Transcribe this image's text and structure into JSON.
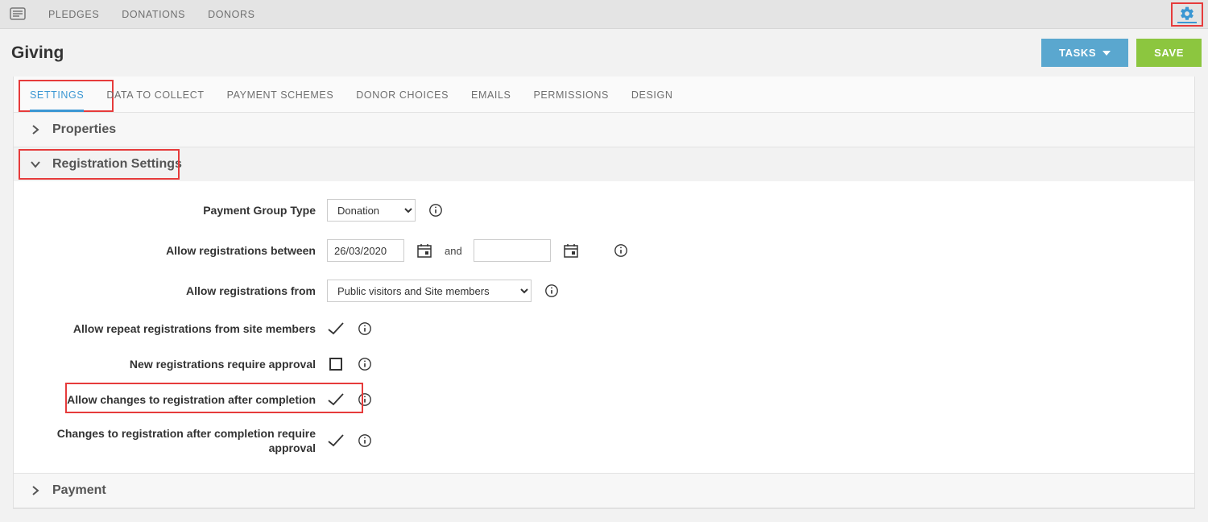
{
  "topnav": {
    "items": [
      "PLEDGES",
      "DONATIONS",
      "DONORS"
    ]
  },
  "header": {
    "title": "Giving",
    "tasks_label": "TASKS",
    "save_label": "SAVE"
  },
  "tabs": [
    "SETTINGS",
    "DATA TO COLLECT",
    "PAYMENT SCHEMES",
    "DONOR CHOICES",
    "EMAILS",
    "PERMISSIONS",
    "DESIGN"
  ],
  "sections": {
    "properties": "Properties",
    "registration": "Registration Settings",
    "payment": "Payment"
  },
  "form": {
    "payment_group_type": {
      "label": "Payment Group Type",
      "value": "Donation"
    },
    "allow_between": {
      "label": "Allow registrations between",
      "from": "26/03/2020",
      "to": "",
      "and": "and"
    },
    "allow_from": {
      "label": "Allow registrations from",
      "value": "Public visitors and Site members"
    },
    "repeat": {
      "label": "Allow repeat registrations from site members",
      "checked": true
    },
    "approval": {
      "label": "New registrations require approval",
      "checked": false
    },
    "changes": {
      "label": "Allow changes to registration after completion",
      "checked": true
    },
    "changes_approval": {
      "label": "Changes to registration after completion require approval",
      "checked": true
    }
  }
}
